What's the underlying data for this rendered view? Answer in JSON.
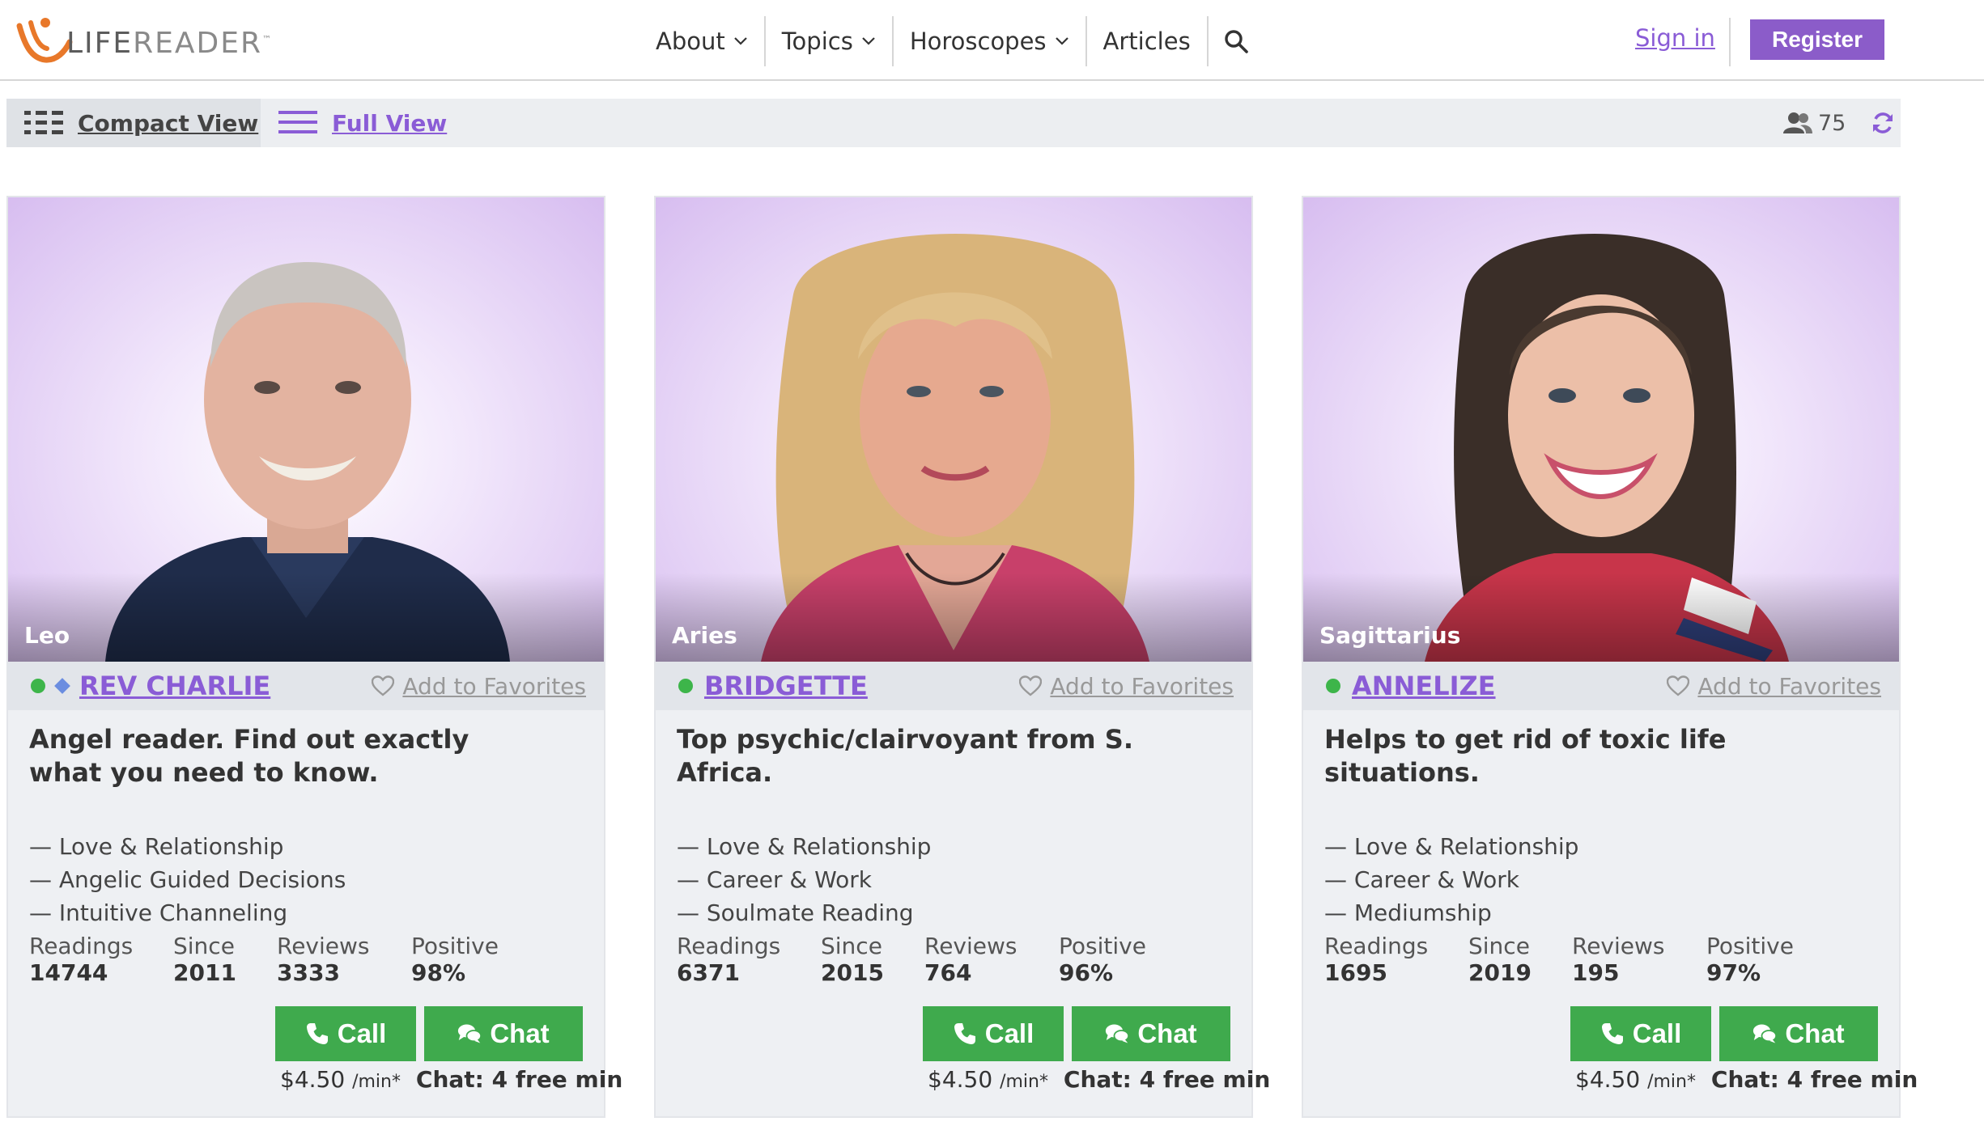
{
  "header": {
    "logo": {
      "life": "LIFE",
      "reader": "READER",
      "tm": "™"
    },
    "nav": [
      {
        "label": "About",
        "has_dropdown": true
      },
      {
        "label": "Topics",
        "has_dropdown": true
      },
      {
        "label": "Horoscopes",
        "has_dropdown": true
      },
      {
        "label": "Articles",
        "has_dropdown": false
      }
    ],
    "search_icon": "search-icon",
    "sign_in": "Sign in",
    "register": "Register"
  },
  "viewbar": {
    "compact": "Compact View",
    "full": "Full View",
    "online_count": "75"
  },
  "colors": {
    "accent": "#8a5cd6",
    "call_green": "#3faa4d",
    "online": "#3db54a"
  },
  "readers": [
    {
      "zodiac": "Leo",
      "name": "REV CHARLIE",
      "favorite": "Add to Favorites",
      "tagline": "Angel reader. Find out exactly what you need to know.",
      "skills": [
        "— Love & Relationship",
        "— Angelic Guided Decisions",
        "— Intuitive Channeling"
      ],
      "stats": {
        "readings_label": "Readings",
        "readings": "14744",
        "since_label": "Since",
        "since": "2011",
        "reviews_label": "Reviews",
        "reviews": "3333",
        "positive_label": "Positive",
        "positive": "98%"
      },
      "call": "Call",
      "chat": "Chat",
      "price": "$4.50",
      "unit": "/min*",
      "chat_free": "Chat: 4 free min"
    },
    {
      "zodiac": "Aries",
      "name": "BRIDGETTE",
      "favorite": "Add to Favorites",
      "tagline": "Top psychic/clairvoyant from S. Africa.",
      "skills": [
        "— Love & Relationship",
        "— Career & Work",
        "— Soulmate Reading"
      ],
      "stats": {
        "readings_label": "Readings",
        "readings": "6371",
        "since_label": "Since",
        "since": "2015",
        "reviews_label": "Reviews",
        "reviews": "764",
        "positive_label": "Positive",
        "positive": "96%"
      },
      "call": "Call",
      "chat": "Chat",
      "price": "$4.50",
      "unit": "/min*",
      "chat_free": "Chat: 4 free min"
    },
    {
      "zodiac": "Sagittarius",
      "name": "ANNELIZE",
      "favorite": "Add to Favorites",
      "tagline": "Helps to get rid of toxic life situations.",
      "skills": [
        "— Love & Relationship",
        "— Career & Work",
        "— Mediumship"
      ],
      "stats": {
        "readings_label": "Readings",
        "readings": "1695",
        "since_label": "Since",
        "since": "2019",
        "reviews_label": "Reviews",
        "reviews": "195",
        "positive_label": "Positive",
        "positive": "97%"
      },
      "call": "Call",
      "chat": "Chat",
      "price": "$4.50",
      "unit": "/min*",
      "chat_free": "Chat: 4 free min"
    }
  ]
}
